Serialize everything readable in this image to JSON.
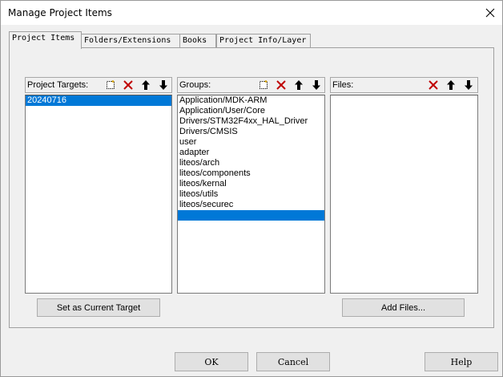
{
  "window": {
    "title": "Manage Project Items"
  },
  "tabs": [
    {
      "label": "Project Items",
      "active": true
    },
    {
      "label": "Folders/Extensions",
      "active": false
    },
    {
      "label": "Books",
      "active": false
    },
    {
      "label": "Project Info/Layer",
      "active": false
    }
  ],
  "targets": {
    "label": "Project Targets:",
    "items": [
      "20240716"
    ],
    "selected_index": 0,
    "button": "Set as Current Target"
  },
  "groups": {
    "label": "Groups:",
    "items": [
      "Application/MDK-ARM",
      "Application/User/Core",
      "Drivers/STM32F4xx_HAL_Driver",
      "Drivers/CMSIS",
      "user",
      "adapter",
      "liteos/arch",
      "liteos/components",
      "liteos/kernal",
      "liteos/utils",
      "liteos/securec",
      ""
    ],
    "selected_index": 11
  },
  "files": {
    "label": "Files:",
    "items": [],
    "button": "Add Files..."
  },
  "footer": {
    "ok": "OK",
    "cancel": "Cancel",
    "help": "Help"
  },
  "icons": {
    "new": "new-item-icon",
    "delete": "delete-icon",
    "up": "move-up-icon",
    "down": "move-down-icon",
    "close": "close-icon"
  },
  "colors": {
    "selection": "#0078d7",
    "delete": "#c00000"
  }
}
